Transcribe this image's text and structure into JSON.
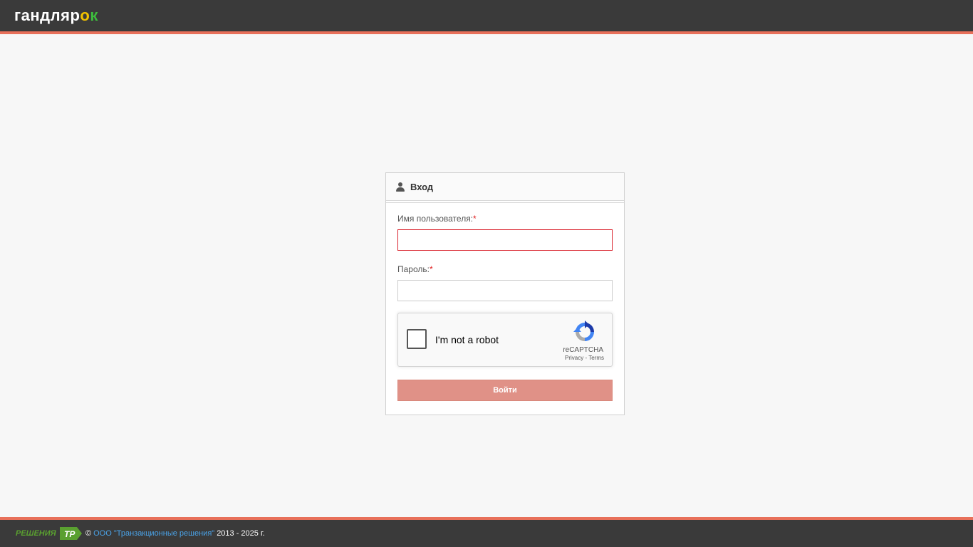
{
  "header": {
    "logo": {
      "part1": "гандляр",
      "part2": "о",
      "part3": "к"
    }
  },
  "login": {
    "title": "Вход",
    "username_label": "Имя пользователя:",
    "password_label": "Пароль:",
    "required_mark": "*",
    "username_value": "",
    "password_value": "",
    "submit_label": "Войти"
  },
  "recaptcha": {
    "label": "I'm not a robot",
    "brand": "reCAPTCHA",
    "privacy": "Privacy",
    "separator": " - ",
    "terms": "Terms"
  },
  "footer": {
    "logo_text": "РЕШЕНИЯ",
    "copyright": "©",
    "company_link": "ООО \"Транзакционные решения\"",
    "years": "2013 -  2025 г."
  },
  "colors": {
    "topbar": "#3a3a3a",
    "accent": "#e8705a",
    "button": "#e09187",
    "link": "#4aa3e8",
    "error_border": "#d9232d"
  }
}
